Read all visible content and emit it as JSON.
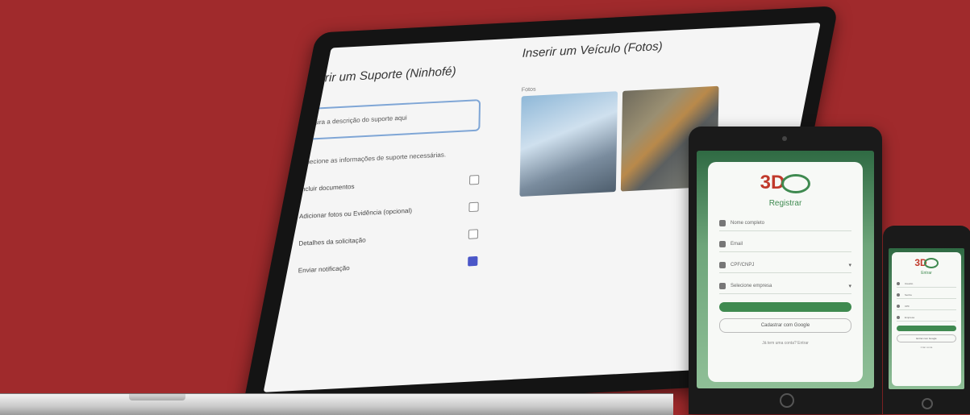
{
  "laptop": {
    "left_title": "Inserir um Suporte (Ninhofé)",
    "textbox_text": "Insira a descrição do suporte aqui",
    "helper_text": "Selecione as informações de suporte necessárias.",
    "options": [
      {
        "label": "Incluir documentos",
        "checked": false
      },
      {
        "label": "Adicionar fotos ou Evidência (opcional)",
        "checked": false
      },
      {
        "label": "Detalhes da solicitação",
        "checked": false
      },
      {
        "label": "Enviar notificação",
        "checked": true
      }
    ],
    "right_title": "Inserir um Veículo (Fotos)",
    "photo_label": "Fotos"
  },
  "tablet": {
    "logo_text": "3D",
    "title": "Registrar",
    "fields": [
      {
        "icon": "user-icon",
        "placeholder": "Nome completo"
      },
      {
        "icon": "email-icon",
        "placeholder": "Email"
      },
      {
        "icon": "id-card-icon",
        "placeholder": "CPF/CNPJ",
        "dropdown": true
      },
      {
        "icon": "building-icon",
        "placeholder": "Selecione empresa",
        "dropdown": true
      }
    ],
    "primary_button": "",
    "secondary_button": "Cadastrar com Google",
    "footer": "Já tem uma conta? Entrar"
  },
  "phone": {
    "logo_text": "3D",
    "title": "Entrar",
    "fields": [
      {
        "icon": "user-icon",
        "placeholder": "Usuário"
      },
      {
        "icon": "lock-icon",
        "placeholder": "Senha"
      },
      {
        "icon": "id-card-icon",
        "placeholder": "CPF"
      },
      {
        "icon": "building-icon",
        "placeholder": "Empresa"
      }
    ],
    "secondary_button": "Entrar com Google",
    "footer": "Criar conta"
  },
  "colors": {
    "background": "#a02a2c",
    "brand_green": "#3f8a50",
    "brand_red": "#c0392b"
  }
}
